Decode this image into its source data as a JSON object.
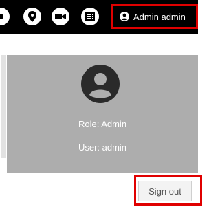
{
  "topbar": {
    "icons": [
      "partial-circle-icon",
      "location-pin-icon",
      "video-camera-icon",
      "grid-icon"
    ],
    "user_button_label": "Admin admin"
  },
  "profile": {
    "role_text": "Role: Admin",
    "user_text": "User: admin"
  },
  "actions": {
    "sign_out_label": "Sign out"
  },
  "colors": {
    "topbar_bg": "#000000",
    "panel_bg": "#adadad",
    "highlight": "#e00000"
  }
}
